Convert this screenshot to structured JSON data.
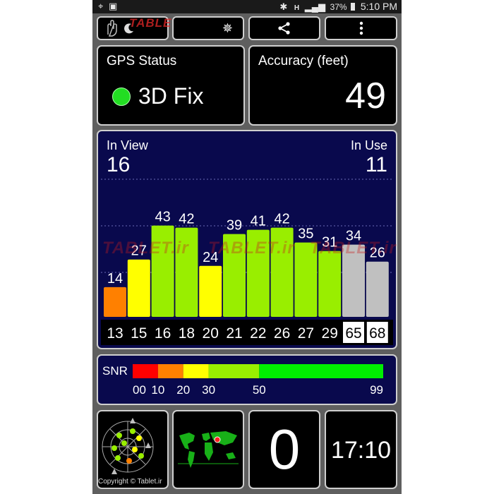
{
  "status_bar": {
    "battery": "37%",
    "time": "5:10 PM",
    "network": "H"
  },
  "watermark": {
    "text": "TABLET.ir",
    "copyright": "Copyright © Tablet.ir"
  },
  "toolbar": {
    "buttons": [
      "gesture-sleep",
      "sun-mode",
      "share",
      "overflow-menu"
    ]
  },
  "gps_status": {
    "title": "GPS Status",
    "fix": "3D Fix",
    "fix_color": "#22dd22"
  },
  "accuracy": {
    "title": "Accuracy (feet)",
    "value": "49"
  },
  "satellites": {
    "in_view_label": "In View",
    "in_view": "16",
    "in_use_label": "In Use",
    "in_use": "11",
    "bars": [
      {
        "prn": "13",
        "snr": 14,
        "color": "#ff8000",
        "used": true
      },
      {
        "prn": "15",
        "snr": 27,
        "color": "#ffff00",
        "used": true
      },
      {
        "prn": "16",
        "snr": 43,
        "color": "#99ee00",
        "used": true
      },
      {
        "prn": "18",
        "snr": 42,
        "color": "#99ee00",
        "used": true
      },
      {
        "prn": "20",
        "snr": 24,
        "color": "#ffff00",
        "used": true
      },
      {
        "prn": "21",
        "snr": 39,
        "color": "#99ee00",
        "used": true
      },
      {
        "prn": "22",
        "snr": 41,
        "color": "#99ee00",
        "used": true
      },
      {
        "prn": "26",
        "snr": 42,
        "color": "#99ee00",
        "used": true
      },
      {
        "prn": "27",
        "snr": 35,
        "color": "#99ee00",
        "used": true
      },
      {
        "prn": "29",
        "snr": 31,
        "color": "#99ee00",
        "used": true
      },
      {
        "prn": "65",
        "snr": 34,
        "color": "#c0c0c0",
        "used": false
      },
      {
        "prn": "68",
        "snr": 26,
        "color": "#c0c0c0",
        "used": false
      }
    ]
  },
  "snr_legend": {
    "label": "SNR",
    "ticks": [
      "00",
      "10",
      "20",
      "30",
      "50",
      "99"
    ],
    "colors": [
      "#ff0000",
      "#ff8000",
      "#ffff00",
      "#99ee00",
      "#00ee00"
    ]
  },
  "bottom_tiles": {
    "sky_view": "sky-view",
    "world_map": "world-map",
    "counter": "0",
    "clock": "17:10"
  }
}
